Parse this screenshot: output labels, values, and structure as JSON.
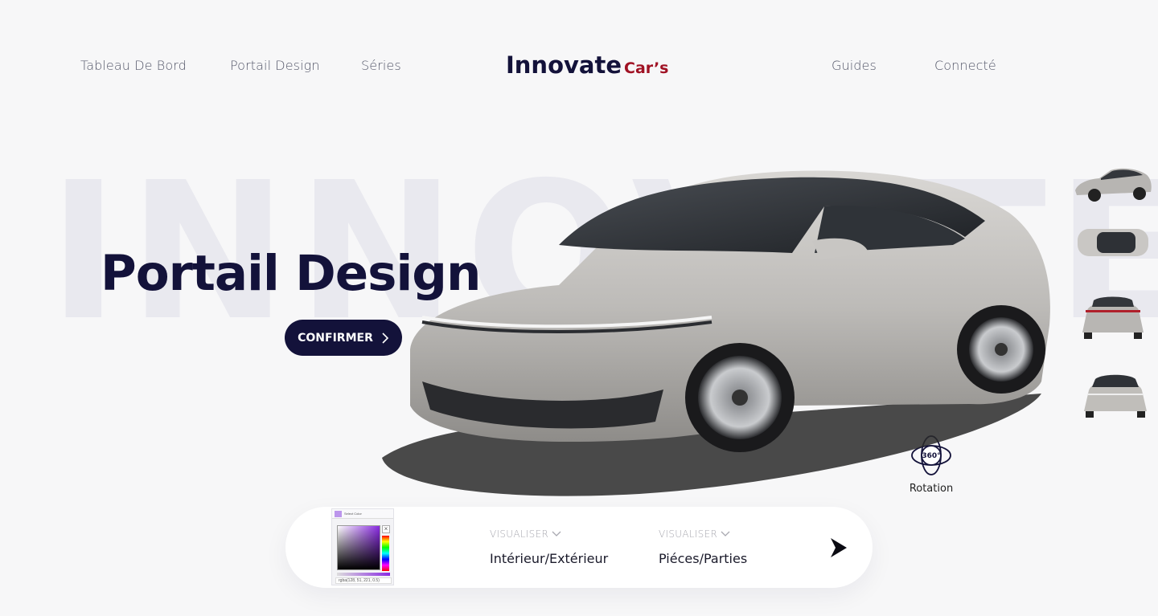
{
  "nav": {
    "left": [
      "Tableau De Bord",
      "Portail Design",
      "Séries"
    ],
    "right": [
      "Guides",
      "Connecté"
    ]
  },
  "logo": {
    "main": "Innovate",
    "accent": "Car’s"
  },
  "hero": {
    "background_word": "INNOVATE",
    "title": "Portail Design",
    "confirm_label": "CONFIRMER"
  },
  "thumbnails": [
    "car-side-view",
    "car-top-view",
    "car-rear-view",
    "car-front-view"
  ],
  "rotation": {
    "badge": "360°",
    "label": "Rotation"
  },
  "bottom_bar": {
    "color_picker": {
      "title": "Select Color",
      "value": "rgba(128, 51, 221, 0.5)"
    },
    "options": [
      {
        "label": "VISUALISER",
        "value": "Intérieur/Extérieur"
      },
      {
        "label": "VISUALISER",
        "value": "Piéces/Parties"
      }
    ]
  },
  "colors": {
    "primary": "#13123a",
    "accent": "#a01224",
    "background": "#f7f7f8",
    "car_body": "#b9b7b4"
  }
}
